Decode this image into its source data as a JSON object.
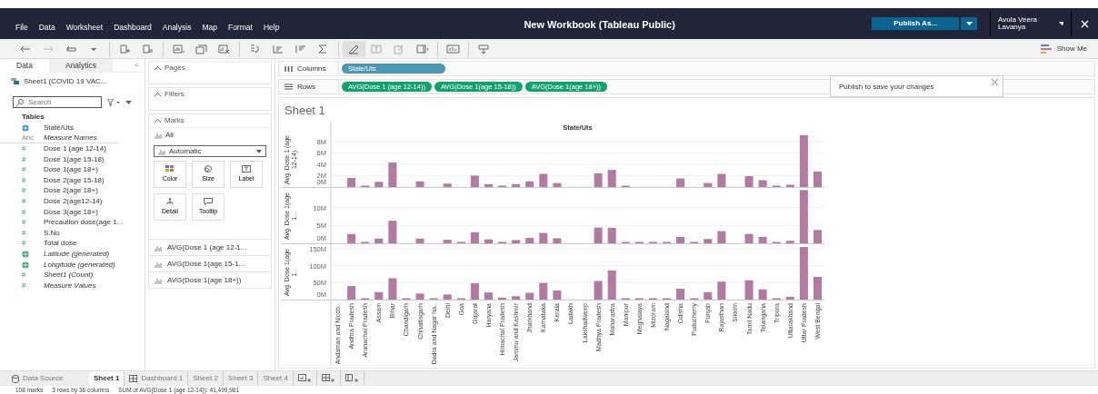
{
  "menu_bar": {
    "items": [
      "File",
      "Data",
      "Worksheet",
      "Dashboard",
      "Analysis",
      "Map",
      "Format",
      "Help"
    ],
    "title": "New Workbook (Tableau Public)",
    "publish_button": "Publish As...",
    "user_name": "Avula Veera Lavanya"
  },
  "publish_popover": {
    "text": "Publish to save your changes"
  },
  "toolbar": {
    "show_me": "Show Me"
  },
  "data_pane": {
    "tabs": [
      {
        "label": "Data",
        "selected": true
      },
      {
        "label": "Analytics",
        "selected": false
      }
    ],
    "collapse": "<",
    "data_source": "Sheet1 (COVID 19 VAC...",
    "search": {
      "placeholder": "Search"
    },
    "section": "Tables",
    "fields": [
      {
        "kind": "geo_dimension",
        "label": "State/Uts",
        "italic": false
      },
      {
        "kind": "text_dimension",
        "icon": "Abc",
        "label": "Measure Names",
        "italic": true
      },
      {
        "kind": "measure",
        "icon": "#",
        "label": "Dose 1 (age 12-14)",
        "italic": false
      },
      {
        "kind": "measure",
        "icon": "#",
        "label": "Dose 1(age 15-18)",
        "italic": false
      },
      {
        "kind": "measure",
        "icon": "#",
        "label": "Dose 1(age 18+)",
        "italic": false
      },
      {
        "kind": "measure",
        "icon": "#",
        "label": "Dose 2(age 15-18)",
        "italic": false
      },
      {
        "kind": "measure",
        "icon": "#",
        "label": "Dose 2(age 18+)",
        "italic": false
      },
      {
        "kind": "measure",
        "icon": "#",
        "label": "Dose 2(age12-14)",
        "italic": false
      },
      {
        "kind": "measure",
        "icon": "#",
        "label": "Dose 3(age 18+)",
        "italic": false
      },
      {
        "kind": "measure",
        "icon": "#",
        "label": "Precaution dose(age 1...",
        "italic": false
      },
      {
        "kind": "measure",
        "icon": "#",
        "label": "S.No",
        "italic": false
      },
      {
        "kind": "measure",
        "icon": "#",
        "label": "Total dose",
        "italic": false
      },
      {
        "kind": "geo_measure",
        "label": "Latitude (generated)",
        "italic": true
      },
      {
        "kind": "geo_measure",
        "label": "Longitude (generated)",
        "italic": true
      },
      {
        "kind": "measure",
        "icon": "#",
        "label": "Sheet1 (Count)",
        "italic": true
      },
      {
        "kind": "measure",
        "icon": "#",
        "label": "Measure Values",
        "italic": true
      }
    ]
  },
  "cards": {
    "pages": "Pages",
    "filters": "Filters",
    "marks": {
      "title": "Marks",
      "all": "All",
      "mark_type": "Automatic",
      "buttons": [
        {
          "kind": "color",
          "label": "Color"
        },
        {
          "kind": "size",
          "label": "Size"
        },
        {
          "kind": "label",
          "label": "Label"
        },
        {
          "kind": "detail",
          "label": "Detail"
        },
        {
          "kind": "tooltip",
          "label": "Tooltip"
        }
      ],
      "measures": [
        "AVG(Dose 1 (age 12-1...",
        "AVG(Dose 1(age 15-1...",
        "AVG(Dose 1(age 18+))"
      ]
    }
  },
  "shelves": [
    {
      "kind": "columns",
      "label": "Columns",
      "pills": [
        "State/Uts"
      ]
    },
    {
      "kind": "rows",
      "label": "Rows",
      "pills": [
        "AVG(Dose 1 (age 12-14))",
        "AVG(Dose 1(age 15-18))",
        "AVG(Dose 1(age 18+))"
      ]
    }
  ],
  "sheet": {
    "title": "Sheet 1",
    "column_header": "State/Uts",
    "panels": [
      {
        "chart_data": {
          "type": "bar",
          "grid": true,
          "ylabel": "Avg. Dose 1 (age 12-14)",
          "ylim": [
            0,
            9.4
          ],
          "yticks": [
            {
              "value": 0,
              "label": "0M"
            },
            {
              "value": 2,
              "label": "2M"
            },
            {
              "value": 4,
              "label": "4M"
            },
            {
              "value": 6,
              "label": "6M"
            },
            {
              "value": 8,
              "label": "8M"
            }
          ],
          "series": [
            {
              "color": "#b07aa1",
              "values": [
                0,
                1.6,
                0.1,
                0.9,
                4.3,
                0,
                1.0,
                0,
                0.6,
                0,
                2.0,
                0.5,
                0.2,
                0.5,
                1.0,
                2.3,
                0.7,
                0,
                0,
                2.4,
                3.0,
                0.1,
                0,
                0,
                0,
                1.5,
                0,
                0.7,
                2.3,
                0,
                1.9,
                1.2,
                0.1,
                0.4,
                9.1,
                2.7
              ]
            }
          ]
        }
      },
      {
        "chart_data": {
          "type": "bar",
          "grid": true,
          "ylabel": "Avg. Dose 1(age 1...",
          "ylim": [
            0,
            15
          ],
          "yticks": [
            {
              "value": 0,
              "label": "0M"
            },
            {
              "value": 5,
              "label": "5M"
            },
            {
              "value": 10,
              "label": "10M"
            }
          ],
          "series": [
            {
              "color": "#b07aa1",
              "values": [
                0,
                2.6,
                0.1,
                1.3,
                6.3,
                0,
                1.3,
                0,
                1.0,
                0.1,
                3.1,
                1.1,
                0.4,
                0.9,
                1.5,
                2.9,
                1.4,
                0,
                0,
                4.4,
                4.3,
                0.2,
                0.2,
                0.1,
                0.1,
                1.8,
                0.1,
                1.2,
                3.4,
                0,
                2.6,
                1.8,
                0.3,
                0.7,
                14.9,
                3.7
              ]
            }
          ]
        }
      },
      {
        "chart_data": {
          "type": "bar",
          "grid": true,
          "ylabel": "Avg. Dose 1(age 1...",
          "ylim": [
            0,
            158
          ],
          "yticks": [
            {
              "value": 0,
              "label": "0M"
            },
            {
              "value": 50,
              "label": "50M"
            },
            {
              "value": 100,
              "label": "100M"
            },
            {
              "value": 150,
              "label": "150M"
            }
          ],
          "categories": [
            "Andaman and Nicob..",
            "Andhra Pradesh",
            "Arunachal Pradesh",
            "Assam",
            "Bihar",
            "Chandigarh",
            "Chhattisgarh",
            "Dadra and Nagar ha..",
            "Delhi",
            "Goa",
            "Gujarat",
            "Haryana",
            "Himachal Pradesh",
            "Jammu and Kashmir",
            "Jharkhand",
            "Karnataka",
            "Kerala",
            "Ladakh",
            "Lakshadweep",
            "Madhya Pradesh",
            "Maharastra",
            "Manipur",
            "Meghalaya",
            "Mizoram",
            "Nagaland",
            "Odisha",
            "Puducherry",
            "Punjab",
            "Rajasthan",
            "Sikkim",
            "Tamil Nadu",
            "Telangana",
            "Tripura",
            "Uttarakhand",
            "Uttar Pradesh",
            "West Bengal"
          ],
          "series": [
            {
              "color": "#b07aa1",
              "values": [
                0,
                40,
                1,
                22,
                63,
                1,
                18,
                1,
                15,
                1,
                48,
                21,
                6,
                10,
                20,
                49,
                27,
                0,
                0,
                55,
                86,
                2,
                2,
                2,
                2,
                32,
                2,
                22,
                53,
                0,
                57,
                30,
                3,
                8,
                155,
                67
              ]
            }
          ]
        }
      }
    ]
  },
  "sheet_tabs": [
    {
      "kind": "data_source",
      "label": "Data Source",
      "selected": false
    },
    {
      "kind": "sheet",
      "label": "Sheet 1",
      "selected": true
    },
    {
      "kind": "dashboard",
      "label": "Dashboard 1",
      "selected": false
    },
    {
      "kind": "sheet",
      "label": "Sheet 2",
      "selected": false
    },
    {
      "kind": "sheet",
      "label": "Sheet 3",
      "selected": false
    },
    {
      "kind": "sheet",
      "label": "Sheet 4",
      "selected": false
    }
  ],
  "status_bar": [
    "108 marks",
    "3 rows by 36 columns",
    "SUM of AVG(Dose 1 (age 12-14)): 41,499,981"
  ]
}
